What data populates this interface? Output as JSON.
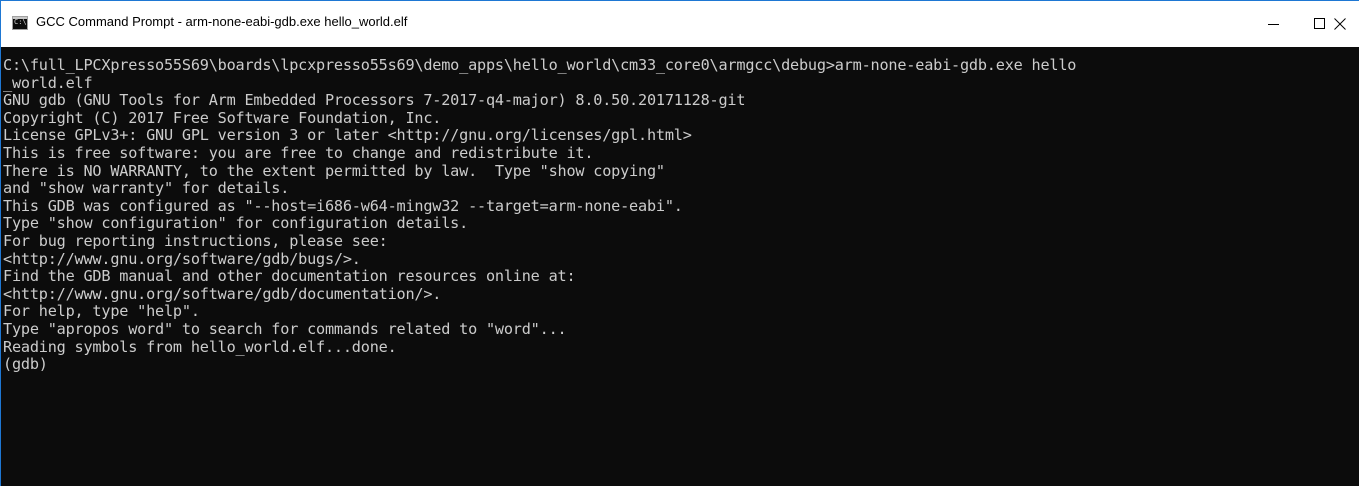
{
  "window": {
    "title": "GCC Command Prompt - arm-none-eabi-gdb.exe  hello_world.elf",
    "icon": "command-prompt-icon",
    "icon_label": "C:\\",
    "controls": {
      "minimize_icon": "minimize-icon",
      "maximize_icon": "maximize-icon",
      "close_icon": "close-icon"
    }
  },
  "console": {
    "background": "#0c0c0c",
    "foreground": "#cccccc",
    "lines": [
      "C:\\full_LPCXpresso55S69\\boards\\lpcxpresso55s69\\demo_apps\\hello_world\\cm33_core0\\armgcc\\debug>arm-none-eabi-gdb.exe hello",
      "_world.elf",
      "GNU gdb (GNU Tools for Arm Embedded Processors 7-2017-q4-major) 8.0.50.20171128-git",
      "Copyright (C) 2017 Free Software Foundation, Inc.",
      "License GPLv3+: GNU GPL version 3 or later <http://gnu.org/licenses/gpl.html>",
      "This is free software: you are free to change and redistribute it.",
      "There is NO WARRANTY, to the extent permitted by law.  Type \"show copying\"",
      "and \"show warranty\" for details.",
      "This GDB was configured as \"--host=i686-w64-mingw32 --target=arm-none-eabi\".",
      "Type \"show configuration\" for configuration details.",
      "For bug reporting instructions, please see:",
      "<http://www.gnu.org/software/gdb/bugs/>.",
      "Find the GDB manual and other documentation resources online at:",
      "<http://www.gnu.org/software/gdb/documentation/>.",
      "For help, type \"help\".",
      "Type \"apropos word\" to search for commands related to \"word\"...",
      "Reading symbols from hello_world.elf...done.",
      "(gdb)"
    ]
  }
}
